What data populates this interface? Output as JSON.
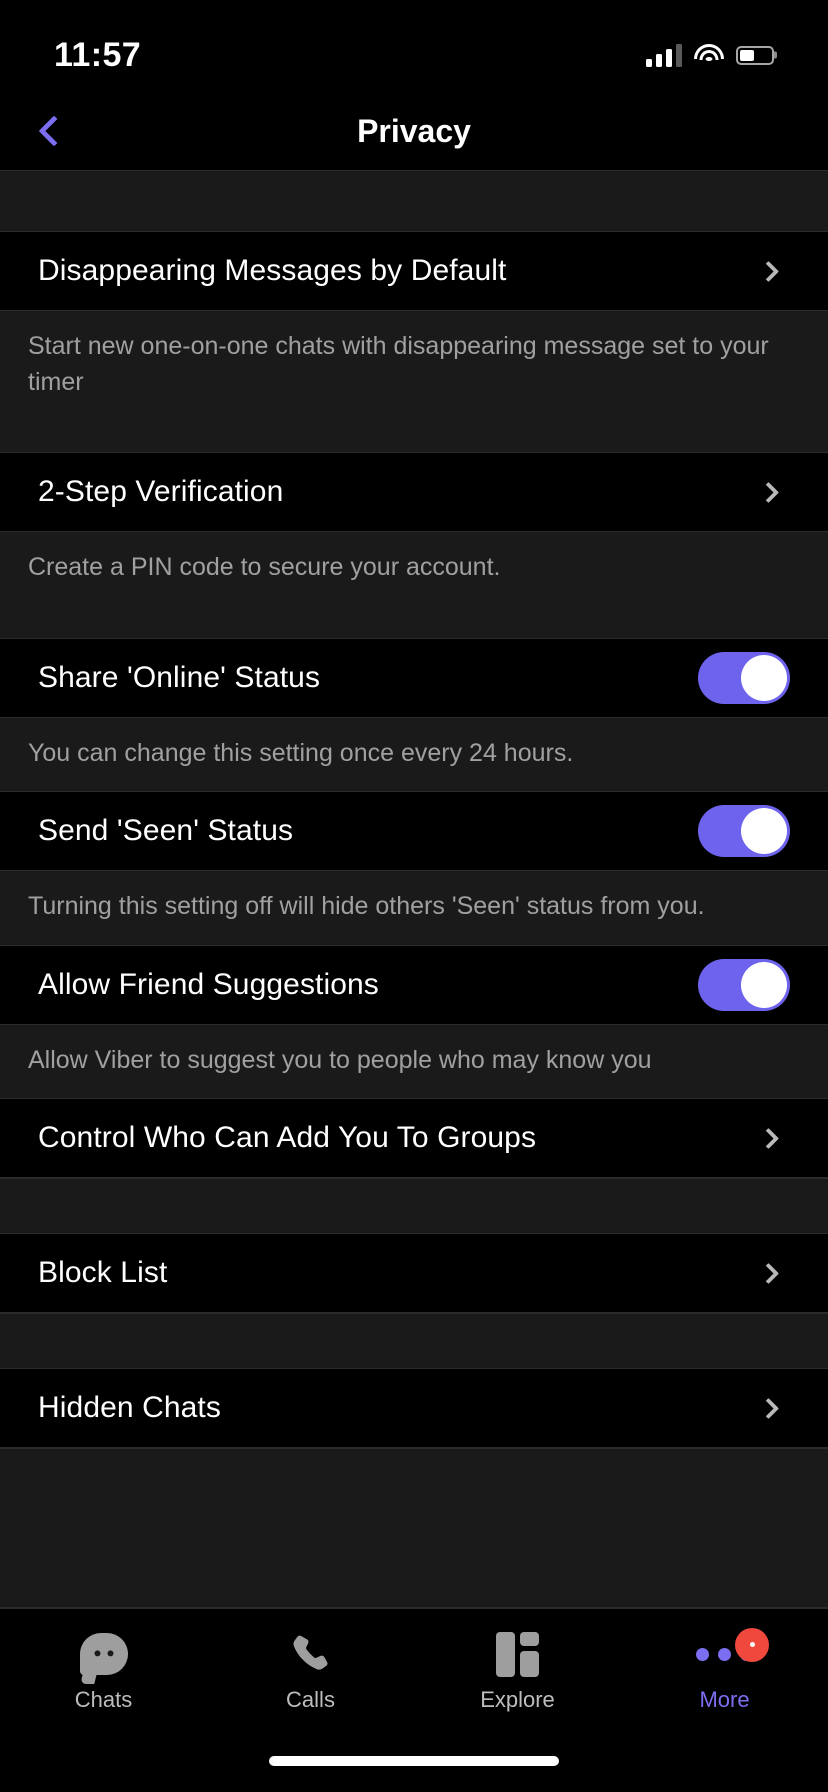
{
  "status_bar": {
    "time": "11:57",
    "signal_icon": "cellular-signal-icon",
    "wifi_icon": "wifi-icon",
    "battery_icon": "battery-icon",
    "battery_level_percent": 46
  },
  "header": {
    "back_icon": "chevron-left-icon",
    "title": "Privacy",
    "accent_color": "#7B6EF0"
  },
  "settings": {
    "chevron_icon": "chevron-right-icon",
    "toggle_on_color": "#6E63EC",
    "groups": [
      {
        "rows": [
          {
            "label": "Disappearing Messages by Default",
            "type": "navigation",
            "description": "Start new one-on-one chats with disappearing message set to your timer"
          },
          {
            "label": "2-Step Verification",
            "type": "navigation",
            "description": "Create a PIN code to secure your account."
          },
          {
            "label": "Share 'Online' Status",
            "type": "toggle",
            "value": "on",
            "description": "You can change this setting once every 24 hours."
          },
          {
            "label": "Send 'Seen' Status",
            "type": "toggle",
            "value": "on",
            "description": "Turning this setting off will hide others 'Seen' status from you."
          },
          {
            "label": "Allow Friend Suggestions",
            "type": "toggle",
            "value": "on",
            "description": "Allow Viber to suggest you to people who may know you"
          },
          {
            "label": "Control Who Can Add You To Groups",
            "type": "navigation",
            "description": ""
          }
        ]
      },
      {
        "rows": [
          {
            "label": "Block List",
            "type": "navigation",
            "description": ""
          }
        ]
      },
      {
        "rows": [
          {
            "label": "Hidden Chats",
            "type": "navigation",
            "description": ""
          }
        ]
      }
    ]
  },
  "tab_bar": {
    "active_tab": "More",
    "active_color": "#7B6EF0",
    "inactive_color": "#bdbdbd",
    "badge_color": "#F0483C",
    "tabs": [
      {
        "label": "Chats",
        "icon": "chat-bubble-icon",
        "active": false
      },
      {
        "label": "Calls",
        "icon": "phone-handset-icon",
        "active": false
      },
      {
        "label": "Explore",
        "icon": "grid-tiles-icon",
        "active": false
      },
      {
        "label": "More",
        "icon": "three-dots-icon",
        "active": true,
        "badge": true
      }
    ]
  }
}
